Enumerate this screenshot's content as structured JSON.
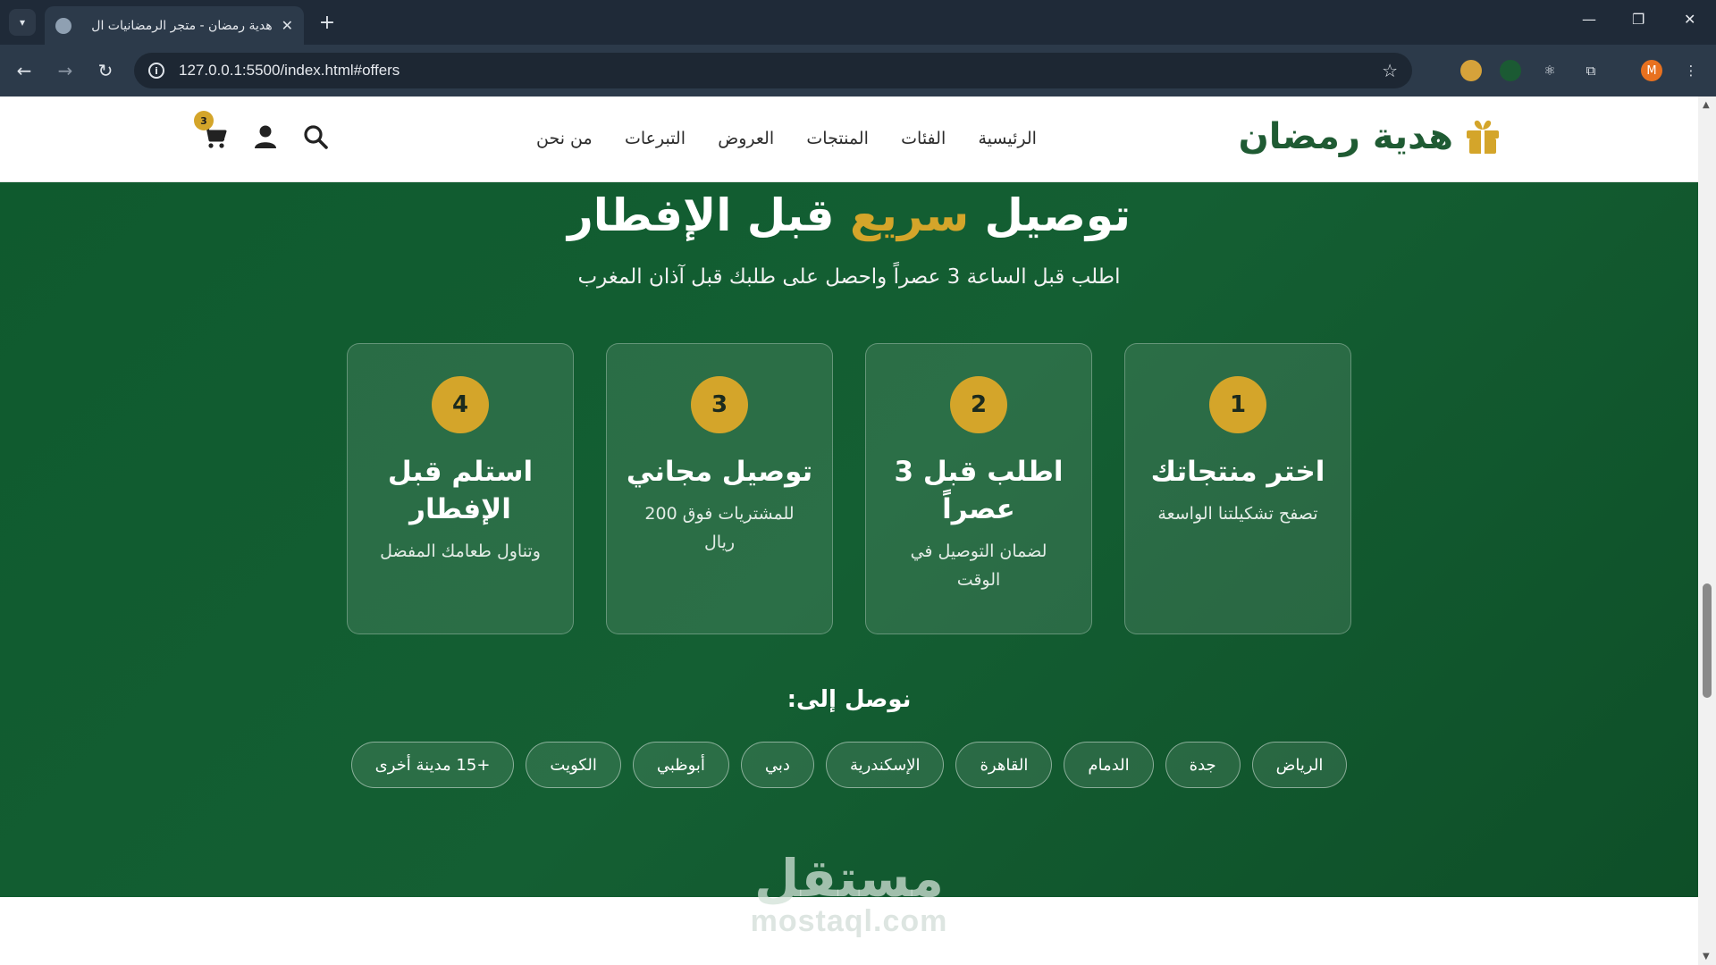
{
  "browser": {
    "tab_title": "هدية رمضان - متجر الرمضانيات ال",
    "url": "127.0.0.1:5500/index.html#offers",
    "profile_initial": "M"
  },
  "header": {
    "logo_text": "هدية رمضان",
    "nav": [
      "الرئيسية",
      "الفئات",
      "المنتجات",
      "العروض",
      "التبرعات",
      "من نحن"
    ],
    "cart_count": "3"
  },
  "delivery": {
    "title_before": "توصيل ",
    "title_accent": "سريع",
    "title_after": " قبل الإفطار",
    "subtitle": "اطلب قبل الساعة 3 عصراً واحصل على طلبك قبل آذان المغرب",
    "steps": [
      {
        "num": "1",
        "title": "اختر منتجاتك",
        "desc": "تصفح تشكيلتنا الواسعة"
      },
      {
        "num": "2",
        "title": "اطلب قبل 3 عصراً",
        "desc": "لضمان التوصيل في الوقت"
      },
      {
        "num": "3",
        "title": "توصيل مجاني",
        "desc": "للمشتريات فوق 200 ريال"
      },
      {
        "num": "4",
        "title": "استلم قبل الإفطار",
        "desc": "وتناول طعامك المفضل"
      }
    ],
    "cities_title": "نوصل إلى:",
    "cities": [
      "الرياض",
      "جدة",
      "الدمام",
      "القاهرة",
      "الإسكندرية",
      "دبي",
      "أبوظبي",
      "الكويت",
      "+15 مدينة أخرى"
    ]
  },
  "watermark": {
    "arabic": "مستقل",
    "latin": "mostaql.com"
  },
  "colors": {
    "green": "#145f33",
    "gold": "#d4a52a",
    "logo_green": "#1f5b33"
  }
}
